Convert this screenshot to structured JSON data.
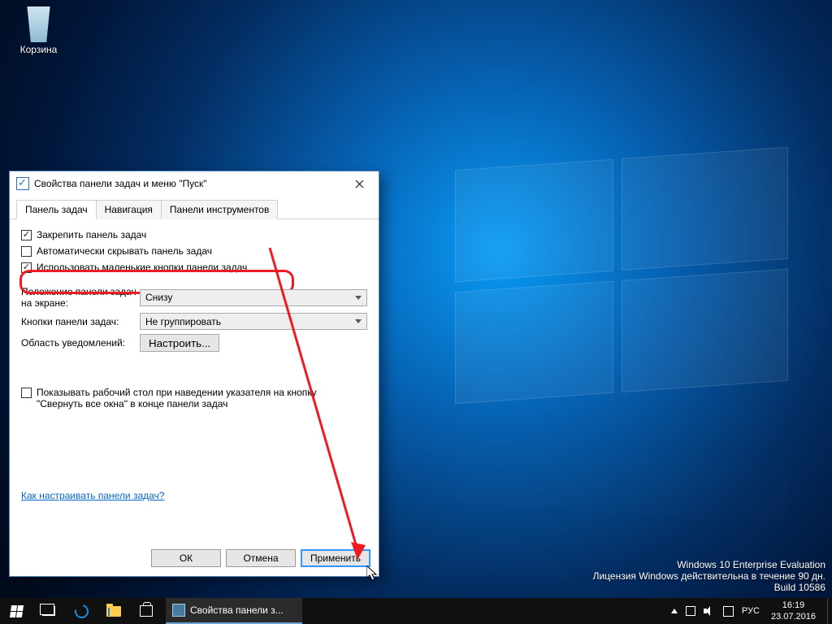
{
  "desktop": {
    "recycle_bin": "Корзина"
  },
  "watermark": {
    "line1": "Windows 10 Enterprise Evaluation",
    "line2": "Лицензия Windows действительна в течение 90 дн.",
    "line3": "Build 10586"
  },
  "dialog": {
    "title": "Свойства панели задач и меню \"Пуск\"",
    "tabs": {
      "0": "Панель задач",
      "1": "Навигация",
      "2": "Панели инструментов"
    },
    "active_tab": 0,
    "checkboxes": {
      "lock": {
        "label": "Закрепить панель задач",
        "checked": true
      },
      "autohide": {
        "label": "Автоматически скрывать панель задач",
        "checked": false
      },
      "small": {
        "label": "Использовать маленькие кнопки панели задач",
        "checked": true
      },
      "peek": {
        "label": "Показывать рабочий стол при наведении указателя на кнопку \"Свернуть все окна\" в конце панели задач",
        "checked": false
      }
    },
    "labels": {
      "position": "Положение панели задач на экране:",
      "buttons": "Кнопки панели задач:",
      "notify": "Область уведомлений:"
    },
    "values": {
      "position": "Снизу",
      "buttons": "Не группировать",
      "notify_btn": "Настроить..."
    },
    "link": "Как настраивать панели задач?",
    "btn_ok": "ОК",
    "btn_cancel": "Отмена",
    "btn_apply": "Применить"
  },
  "taskbar": {
    "task": "Свойства панели з...",
    "lang": "РУС",
    "time": "16:19",
    "date": "23.07.2016"
  }
}
